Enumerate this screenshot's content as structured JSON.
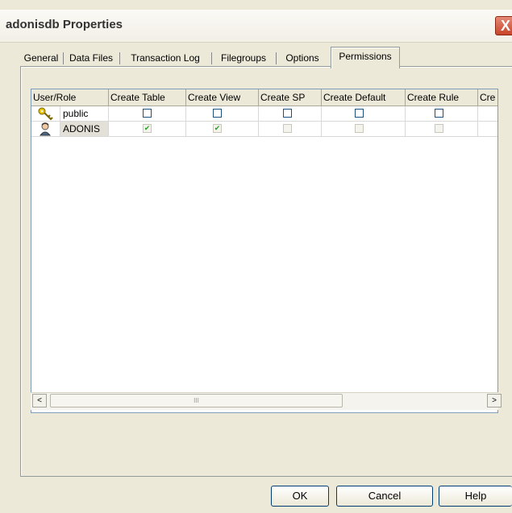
{
  "window": {
    "title": "adonisdb Properties",
    "close_glyph": "X"
  },
  "tabs": [
    {
      "label": "General"
    },
    {
      "label": "Data Files"
    },
    {
      "label": "Transaction Log"
    },
    {
      "label": "Filegroups"
    },
    {
      "label": "Options"
    },
    {
      "label": "Permissions",
      "active": true
    }
  ],
  "grid": {
    "columns": [
      "User/Role",
      "Create Table",
      "Create View",
      "Create SP",
      "Create Default",
      "Create Rule",
      "Cre"
    ],
    "rows": [
      {
        "name": "public",
        "icon": "key-icon",
        "checks": [
          false,
          false,
          false,
          false,
          false
        ],
        "enabled": true,
        "selected": false
      },
      {
        "name": "ADONIS",
        "icon": "user-icon",
        "checks": [
          true,
          true,
          false,
          false,
          false
        ],
        "enabled": false,
        "selected": true
      }
    ]
  },
  "scrollbar": {
    "left_arrow": "<",
    "right_arrow": ">",
    "grip": "III"
  },
  "buttons": {
    "ok": "OK",
    "cancel": "Cancel",
    "help": "Help"
  },
  "colors": {
    "header_bg": "#ece9d8",
    "grid_border": "#7f9db9",
    "check_green": "#21a121"
  }
}
